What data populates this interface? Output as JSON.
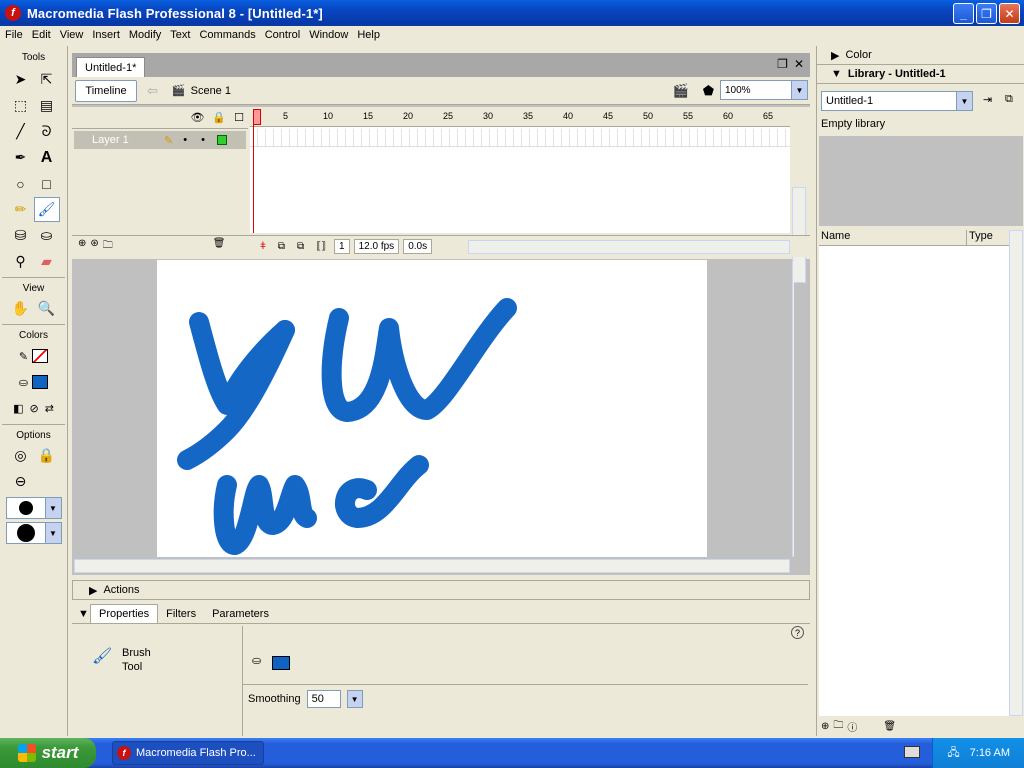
{
  "window": {
    "title": "Macromedia Flash Professional 8 - [Untitled-1*]",
    "app_icon_glyph": "f",
    "minimize": "_",
    "maximize": "❐",
    "close": "✕"
  },
  "menu": [
    "File",
    "Edit",
    "View",
    "Insert",
    "Modify",
    "Text",
    "Commands",
    "Control",
    "Window",
    "Help"
  ],
  "tools": {
    "header": "Tools",
    "view_label": "View",
    "colors_label": "Colors",
    "options_label": "Options",
    "stroke_color": "#ff0000",
    "fill_color": "#1063c0"
  },
  "document": {
    "tab_label": "Untitled-1*",
    "timeline_button": "Timeline",
    "scene_label": "Scene 1",
    "zoom": "100%",
    "layer_name": "Layer 1",
    "ruler_ticks": [
      "1",
      "5",
      "10",
      "15",
      "20",
      "25",
      "30",
      "35",
      "40",
      "45",
      "50",
      "55",
      "60",
      "65"
    ],
    "current_frame": "1",
    "fps": "12.0 fps",
    "elapsed": "0.0s",
    "brush_color": "#1467c4"
  },
  "panels": {
    "actions": "Actions",
    "properties_tab": "Properties",
    "filters_tab": "Filters",
    "parameters_tab": "Parameters",
    "tool_name_line1": "Brush",
    "tool_name_line2": "Tool",
    "smoothing_label": "Smoothing",
    "smoothing_value": "50",
    "help_glyph": "?"
  },
  "right_panel": {
    "color_header": "Color",
    "library_header": "Library - Untitled-1",
    "library_select": "Untitled-1",
    "empty_library": "Empty library",
    "col_name": "Name",
    "col_type": "Type"
  },
  "taskbar": {
    "start": "start",
    "task_label": "Macromedia Flash Pro...",
    "time": "7:16 AM"
  }
}
